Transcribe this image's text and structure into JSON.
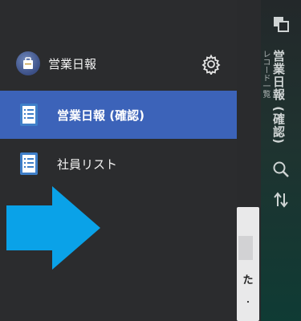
{
  "drawer": {
    "app_title": "営業日報",
    "app_icon": "briefcase-icon",
    "settings_icon": "gear-icon",
    "items": [
      {
        "label": "営業日報 (確認)",
        "icon": "list-document-icon",
        "active": true
      },
      {
        "label": "社員リスト",
        "icon": "list-document-icon",
        "active": false
      }
    ]
  },
  "background_app": {
    "toolbar_title": "営業日報 (確認)",
    "toolbar_subtitle": "レコード一覧",
    "toolbar_icons": [
      "layers-icon",
      "search-icon",
      "sort-icon"
    ],
    "card_text": "た",
    "card_dot": "・"
  },
  "overlay": {
    "arrow": "right-arrow-icon",
    "arrow_color": "#0aa2e8"
  },
  "colors": {
    "drawer_bg": "#2b2c2e",
    "active_bg": "#3c63b9",
    "text": "#f2f2f2"
  }
}
